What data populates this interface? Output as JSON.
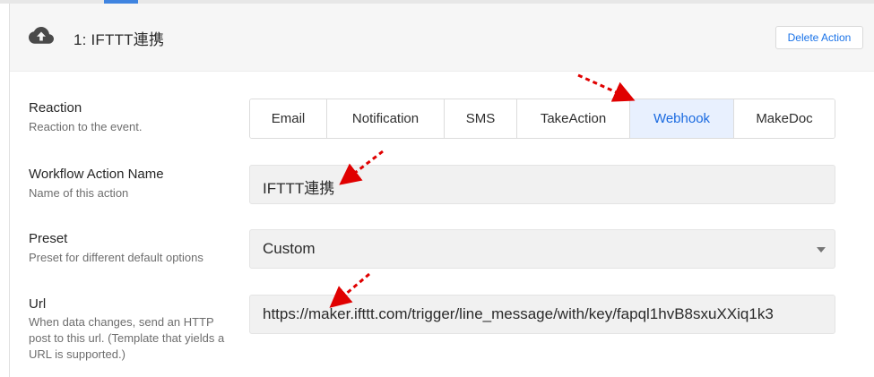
{
  "header": {
    "title": "1: IFTTT連携",
    "delete_label": "Delete Action"
  },
  "reaction": {
    "label": "Reaction",
    "description": "Reaction to the event.",
    "options": [
      "Email",
      "Notification",
      "SMS",
      "TakeAction",
      "Webhook",
      "MakeDoc"
    ],
    "selected": "Webhook"
  },
  "workflow_name": {
    "label": "Workflow Action Name",
    "description": "Name of this action",
    "value": "IFTTT連携"
  },
  "preset": {
    "label": "Preset",
    "description": "Preset for different default options",
    "value": "Custom"
  },
  "url": {
    "label": "Url",
    "description": "When data changes, send an HTTP post to this url. (Template that yields a URL is supported.)",
    "value": "https://maker.ifttt.com/trigger/line_message/with/key/fapql1hvB8sxuXXiq1k3"
  },
  "colors": {
    "accent": "#1a73e8",
    "selected_bg": "#e8f0fe",
    "annotation": "#e00000",
    "header_bg": "#f6f6f6"
  },
  "icons": {
    "header": "cloud-upload-icon",
    "select": "caret-down-icon"
  }
}
